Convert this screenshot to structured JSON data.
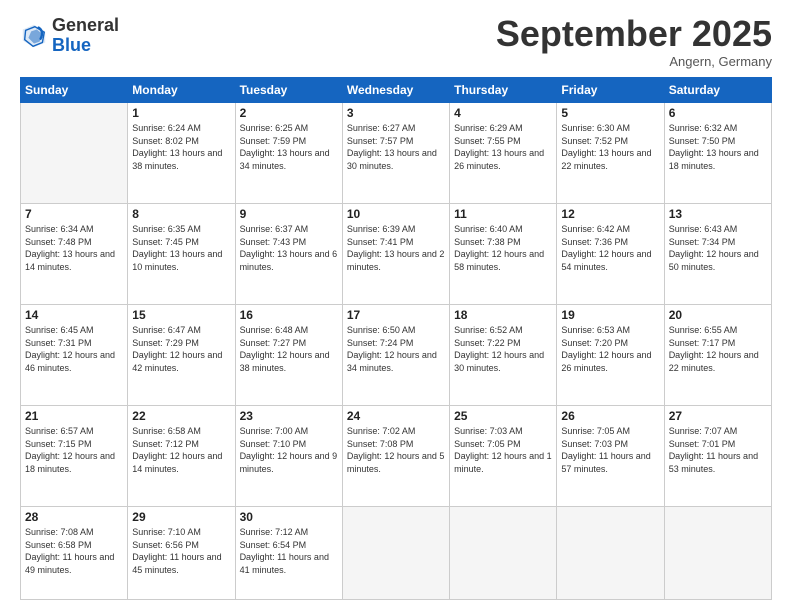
{
  "header": {
    "logo_general": "General",
    "logo_blue": "Blue",
    "month_title": "September 2025",
    "location": "Angern, Germany"
  },
  "weekdays": [
    "Sunday",
    "Monday",
    "Tuesday",
    "Wednesday",
    "Thursday",
    "Friday",
    "Saturday"
  ],
  "days": [
    {
      "num": "",
      "sunrise": "",
      "sunset": "",
      "daylight": "",
      "empty": true
    },
    {
      "num": "1",
      "sunrise": "Sunrise: 6:24 AM",
      "sunset": "Sunset: 8:02 PM",
      "daylight": "Daylight: 13 hours and 38 minutes."
    },
    {
      "num": "2",
      "sunrise": "Sunrise: 6:25 AM",
      "sunset": "Sunset: 7:59 PM",
      "daylight": "Daylight: 13 hours and 34 minutes."
    },
    {
      "num": "3",
      "sunrise": "Sunrise: 6:27 AM",
      "sunset": "Sunset: 7:57 PM",
      "daylight": "Daylight: 13 hours and 30 minutes."
    },
    {
      "num": "4",
      "sunrise": "Sunrise: 6:29 AM",
      "sunset": "Sunset: 7:55 PM",
      "daylight": "Daylight: 13 hours and 26 minutes."
    },
    {
      "num": "5",
      "sunrise": "Sunrise: 6:30 AM",
      "sunset": "Sunset: 7:52 PM",
      "daylight": "Daylight: 13 hours and 22 minutes."
    },
    {
      "num": "6",
      "sunrise": "Sunrise: 6:32 AM",
      "sunset": "Sunset: 7:50 PM",
      "daylight": "Daylight: 13 hours and 18 minutes."
    },
    {
      "num": "7",
      "sunrise": "Sunrise: 6:34 AM",
      "sunset": "Sunset: 7:48 PM",
      "daylight": "Daylight: 13 hours and 14 minutes."
    },
    {
      "num": "8",
      "sunrise": "Sunrise: 6:35 AM",
      "sunset": "Sunset: 7:45 PM",
      "daylight": "Daylight: 13 hours and 10 minutes."
    },
    {
      "num": "9",
      "sunrise": "Sunrise: 6:37 AM",
      "sunset": "Sunset: 7:43 PM",
      "daylight": "Daylight: 13 hours and 6 minutes."
    },
    {
      "num": "10",
      "sunrise": "Sunrise: 6:39 AM",
      "sunset": "Sunset: 7:41 PM",
      "daylight": "Daylight: 13 hours and 2 minutes."
    },
    {
      "num": "11",
      "sunrise": "Sunrise: 6:40 AM",
      "sunset": "Sunset: 7:38 PM",
      "daylight": "Daylight: 12 hours and 58 minutes."
    },
    {
      "num": "12",
      "sunrise": "Sunrise: 6:42 AM",
      "sunset": "Sunset: 7:36 PM",
      "daylight": "Daylight: 12 hours and 54 minutes."
    },
    {
      "num": "13",
      "sunrise": "Sunrise: 6:43 AM",
      "sunset": "Sunset: 7:34 PM",
      "daylight": "Daylight: 12 hours and 50 minutes."
    },
    {
      "num": "14",
      "sunrise": "Sunrise: 6:45 AM",
      "sunset": "Sunset: 7:31 PM",
      "daylight": "Daylight: 12 hours and 46 minutes."
    },
    {
      "num": "15",
      "sunrise": "Sunrise: 6:47 AM",
      "sunset": "Sunset: 7:29 PM",
      "daylight": "Daylight: 12 hours and 42 minutes."
    },
    {
      "num": "16",
      "sunrise": "Sunrise: 6:48 AM",
      "sunset": "Sunset: 7:27 PM",
      "daylight": "Daylight: 12 hours and 38 minutes."
    },
    {
      "num": "17",
      "sunrise": "Sunrise: 6:50 AM",
      "sunset": "Sunset: 7:24 PM",
      "daylight": "Daylight: 12 hours and 34 minutes."
    },
    {
      "num": "18",
      "sunrise": "Sunrise: 6:52 AM",
      "sunset": "Sunset: 7:22 PM",
      "daylight": "Daylight: 12 hours and 30 minutes."
    },
    {
      "num": "19",
      "sunrise": "Sunrise: 6:53 AM",
      "sunset": "Sunset: 7:20 PM",
      "daylight": "Daylight: 12 hours and 26 minutes."
    },
    {
      "num": "20",
      "sunrise": "Sunrise: 6:55 AM",
      "sunset": "Sunset: 7:17 PM",
      "daylight": "Daylight: 12 hours and 22 minutes."
    },
    {
      "num": "21",
      "sunrise": "Sunrise: 6:57 AM",
      "sunset": "Sunset: 7:15 PM",
      "daylight": "Daylight: 12 hours and 18 minutes."
    },
    {
      "num": "22",
      "sunrise": "Sunrise: 6:58 AM",
      "sunset": "Sunset: 7:12 PM",
      "daylight": "Daylight: 12 hours and 14 minutes."
    },
    {
      "num": "23",
      "sunrise": "Sunrise: 7:00 AM",
      "sunset": "Sunset: 7:10 PM",
      "daylight": "Daylight: 12 hours and 9 minutes."
    },
    {
      "num": "24",
      "sunrise": "Sunrise: 7:02 AM",
      "sunset": "Sunset: 7:08 PM",
      "daylight": "Daylight: 12 hours and 5 minutes."
    },
    {
      "num": "25",
      "sunrise": "Sunrise: 7:03 AM",
      "sunset": "Sunset: 7:05 PM",
      "daylight": "Daylight: 12 hours and 1 minute."
    },
    {
      "num": "26",
      "sunrise": "Sunrise: 7:05 AM",
      "sunset": "Sunset: 7:03 PM",
      "daylight": "Daylight: 11 hours and 57 minutes."
    },
    {
      "num": "27",
      "sunrise": "Sunrise: 7:07 AM",
      "sunset": "Sunset: 7:01 PM",
      "daylight": "Daylight: 11 hours and 53 minutes."
    },
    {
      "num": "28",
      "sunrise": "Sunrise: 7:08 AM",
      "sunset": "Sunset: 6:58 PM",
      "daylight": "Daylight: 11 hours and 49 minutes."
    },
    {
      "num": "29",
      "sunrise": "Sunrise: 7:10 AM",
      "sunset": "Sunset: 6:56 PM",
      "daylight": "Daylight: 11 hours and 45 minutes."
    },
    {
      "num": "30",
      "sunrise": "Sunrise: 7:12 AM",
      "sunset": "Sunset: 6:54 PM",
      "daylight": "Daylight: 11 hours and 41 minutes."
    },
    {
      "num": "",
      "sunrise": "",
      "sunset": "",
      "daylight": "",
      "empty": true
    },
    {
      "num": "",
      "sunrise": "",
      "sunset": "",
      "daylight": "",
      "empty": true
    },
    {
      "num": "",
      "sunrise": "",
      "sunset": "",
      "daylight": "",
      "empty": true
    },
    {
      "num": "",
      "sunrise": "",
      "sunset": "",
      "daylight": "",
      "empty": true
    }
  ]
}
